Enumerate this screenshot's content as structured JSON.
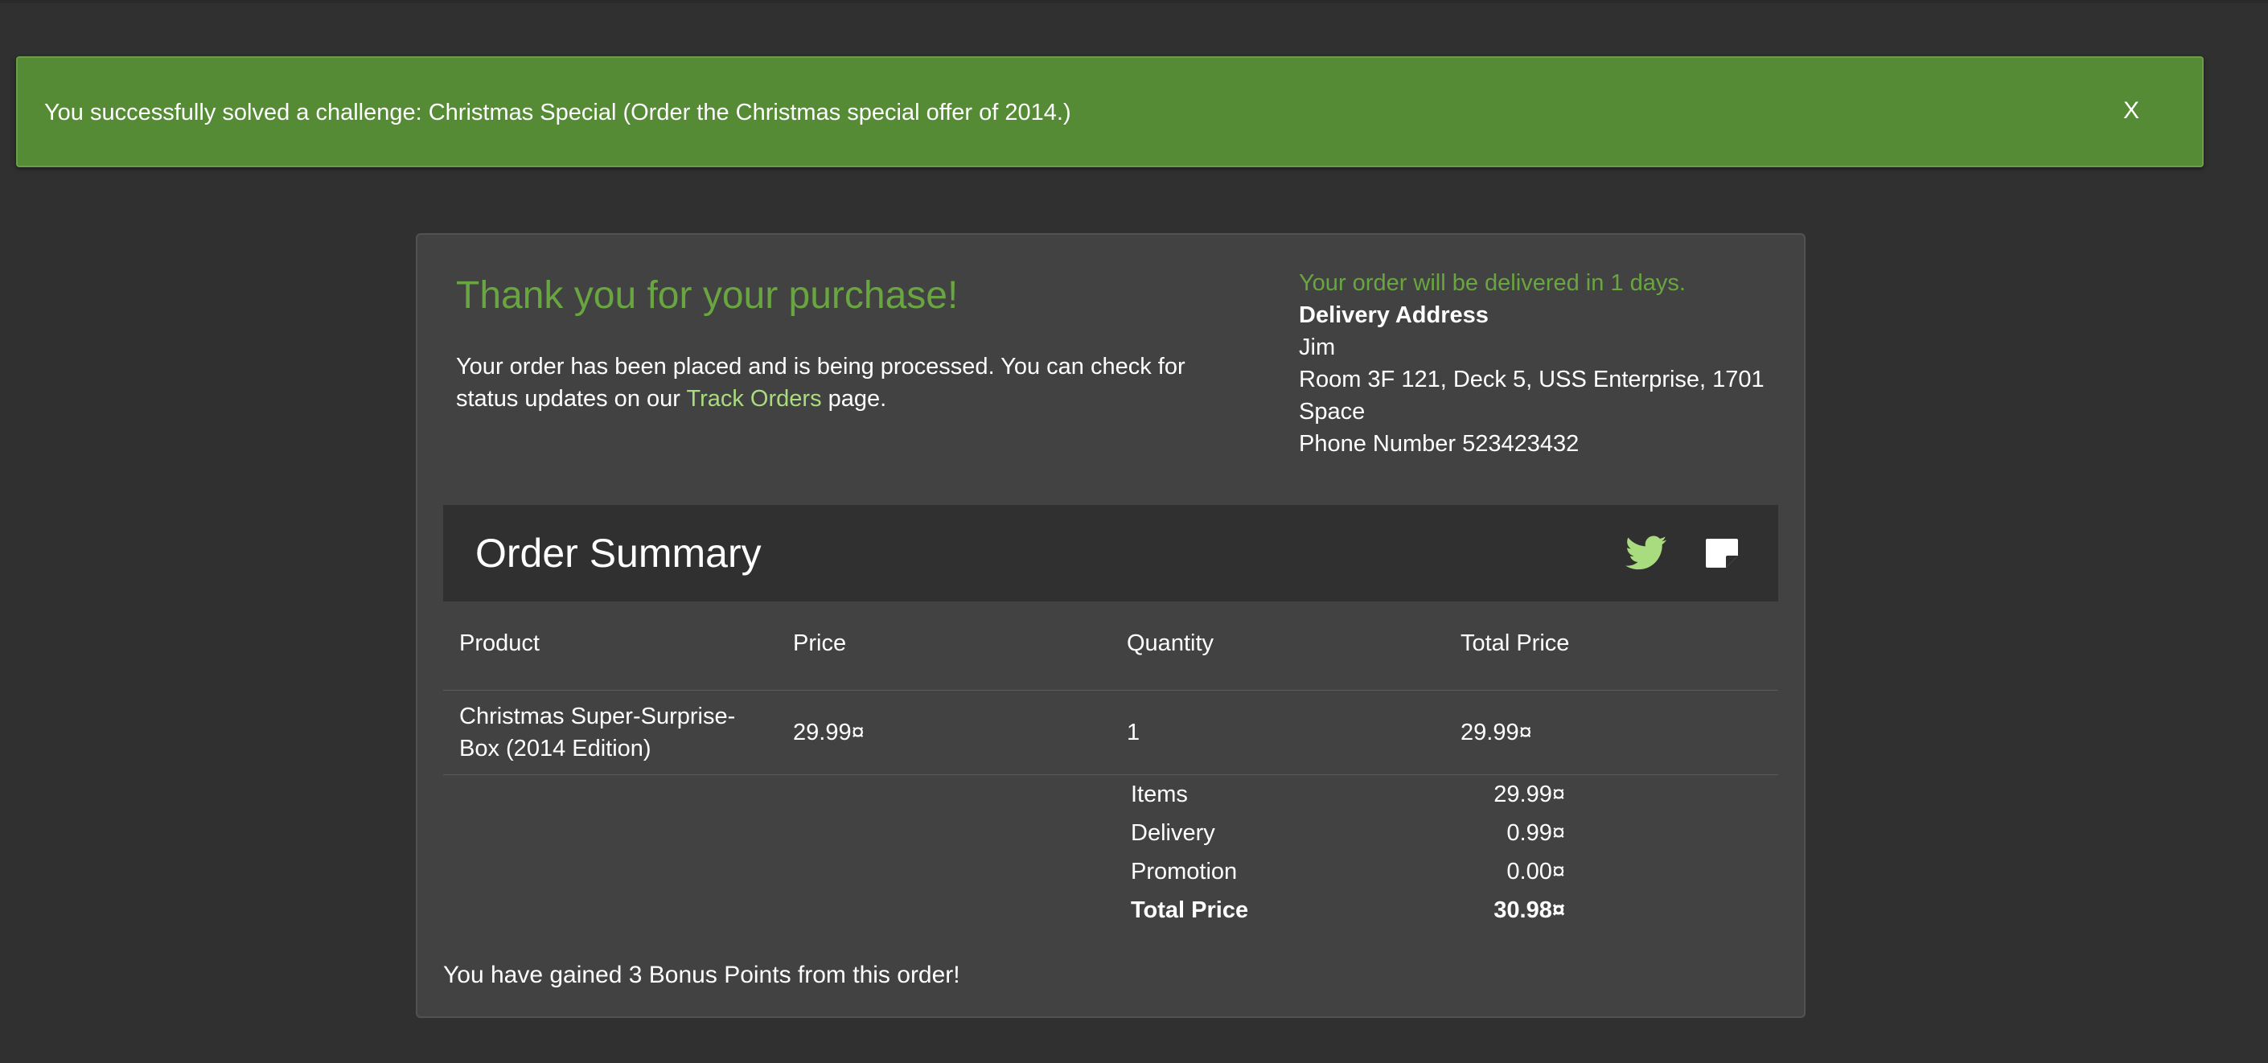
{
  "notification": {
    "message": "You successfully solved a challenge: Christmas Special (Order the Christmas special offer of 2014.)",
    "close_label": "X",
    "color": "#558b35"
  },
  "confirmation": {
    "title": "Thank you for your purchase!",
    "body_before_link": "Your order has been placed and is being processed. You can check for status updates on our ",
    "link_text": "Track Orders",
    "body_after_link": " page.",
    "accent_color": "#69a540"
  },
  "delivery": {
    "eta": "Your order will be delivered in 1 days.",
    "heading": "Delivery Address",
    "name": "Jim",
    "address_line": "Room 3F 121, Deck 5, USS Enterprise, 1701",
    "region": "Space",
    "phone": "Phone Number 523423432"
  },
  "order_summary": {
    "title": "Order Summary",
    "icons": {
      "tweet": "twitter-bird-icon",
      "share": "bookmark-note-icon"
    },
    "columns": [
      "Product",
      "Price",
      "Quantity",
      "Total Price"
    ],
    "rows": [
      {
        "product": "Christmas Super-Surprise-Box (2014 Edition)",
        "price": "29.99¤",
        "quantity": "1",
        "total": "29.99¤"
      }
    ],
    "totals": [
      {
        "label": "Items",
        "value": "29.99¤"
      },
      {
        "label": "Delivery",
        "value": "0.99¤"
      },
      {
        "label": "Promotion",
        "value": "0.00¤"
      },
      {
        "label": "Total Price",
        "value": "30.98¤"
      }
    ]
  },
  "bonus_message": "You have gained 3 Bonus Points from this order!"
}
